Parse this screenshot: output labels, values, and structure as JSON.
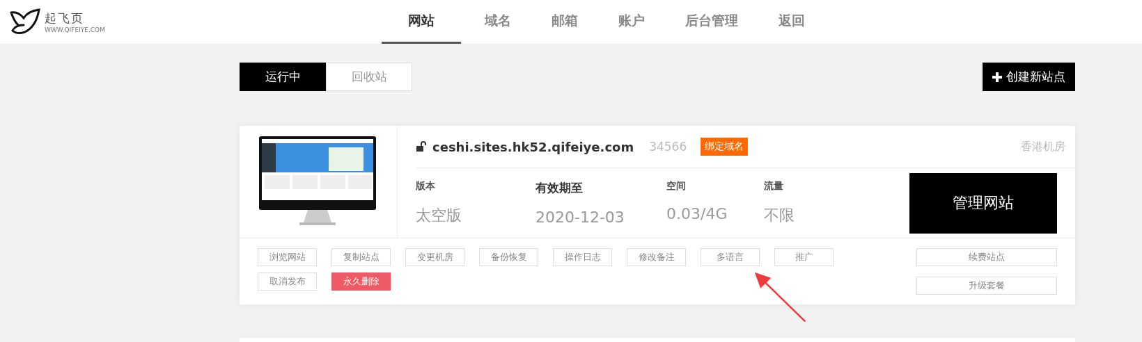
{
  "logo": {
    "name": "起飞页",
    "url": "WWW.QIFEIYE.COM"
  },
  "nav": [
    {
      "label": "网站",
      "selected": true
    },
    {
      "label": "域名",
      "selected": false
    },
    {
      "label": "邮箱",
      "selected": false
    },
    {
      "label": "账户",
      "selected": false
    },
    {
      "label": "后台管理",
      "selected": false
    },
    {
      "label": "返回",
      "selected": false
    }
  ],
  "status_tabs": [
    {
      "label": "运行中",
      "selected": true
    },
    {
      "label": "回收站",
      "selected": false
    }
  ],
  "create_button": "创建新站点",
  "site": {
    "domain": "ceshi.sites.hk52.qifeiye.com",
    "id": "34566",
    "bind_button": "绑定域名",
    "region": "香港机房",
    "stats": [
      {
        "label": "版本",
        "value": "太空版"
      },
      {
        "label": "有效期至",
        "value": "2020-12-03"
      },
      {
        "label": "空间",
        "value": "0.03/4G"
      },
      {
        "label": "流量",
        "value": "不限"
      }
    ],
    "manage_button": "管理网站",
    "actions": [
      {
        "label": "浏览网站",
        "kind": "normal"
      },
      {
        "label": "复制站点",
        "kind": "normal"
      },
      {
        "label": "变更机房",
        "kind": "normal"
      },
      {
        "label": "备份恢复",
        "kind": "normal"
      },
      {
        "label": "操作日志",
        "kind": "normal"
      },
      {
        "label": "修改备注",
        "kind": "normal"
      },
      {
        "label": "多语言",
        "kind": "normal"
      },
      {
        "label": "推广",
        "kind": "normal"
      },
      {
        "label": "取消发布",
        "kind": "normal"
      },
      {
        "label": "永久删除",
        "kind": "danger"
      }
    ],
    "side_actions": [
      "续费站点",
      "升级套餐"
    ]
  }
}
